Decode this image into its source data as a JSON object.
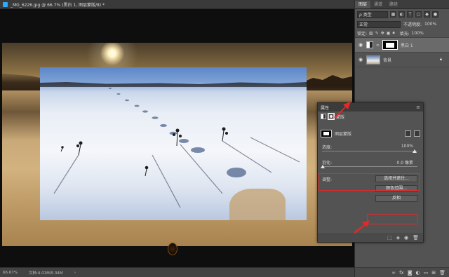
{
  "document": {
    "tab_title": "_MG_6226.jpg @ 66.7% (黑白 1, 图层蒙版/8) *",
    "zoom": "66.67%",
    "doc_info": "文档:4.01M/5.34M",
    "status_arrow": "›"
  },
  "layers_panel": {
    "tabs": [
      "图层",
      "通道",
      "路径"
    ],
    "kind_label": "ρ 类型",
    "blend_mode": "正常",
    "opacity_label": "不透明度:",
    "opacity_value": "100%",
    "lock_label": "锁定:",
    "fill_label": "填充:",
    "fill_value": "100%",
    "layers": [
      {
        "name": "黑白 1",
        "selected": true
      },
      {
        "name": "背景",
        "selected": false
      }
    ],
    "bottom_icons": [
      "link-icon",
      "fx-icon",
      "mask-icon",
      "adjustment-icon",
      "group-icon",
      "new-layer-icon",
      "trash-icon"
    ]
  },
  "properties_panel": {
    "title": "属性",
    "mode_label": "蒙版",
    "mask_type": "图层蒙版",
    "density_label": "浓度:",
    "density_value": "100%",
    "feather_label": "羽化:",
    "feather_value": "0.0 像素",
    "adjust_label": "调整:",
    "select_mask_button": "选择并遮住...",
    "color_range_button": "颜色范围...",
    "invert_button": "反相"
  },
  "annotation_color": "#e02a2a"
}
